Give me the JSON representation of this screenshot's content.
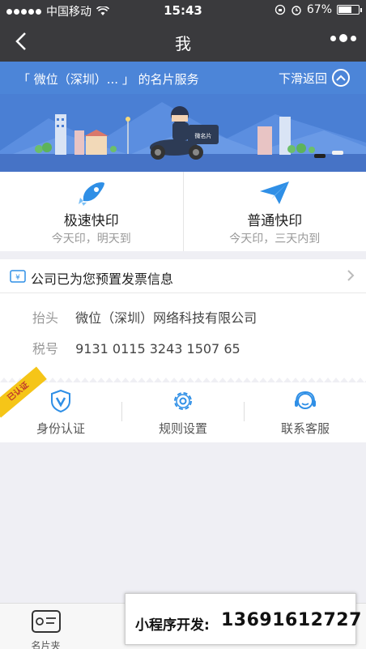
{
  "status_bar": {
    "carrier": "中国移动",
    "time": "15:43",
    "battery_percent": "67%",
    "battery_level": 0.67
  },
  "nav": {
    "title": "我"
  },
  "banner": {
    "service_prefix": "「 微位（深圳）...  」 的名片服务",
    "slide_back": "下滑返回",
    "scooter_text": "微名片"
  },
  "print_options": [
    {
      "name": "极速快印",
      "desc": "今天印，明天到",
      "icon": "rocket-icon"
    },
    {
      "name": "普通快印",
      "desc": "今天印，三天内到",
      "icon": "paper-plane-icon"
    }
  ],
  "invoice": {
    "header": "公司已为您预置发票信息",
    "title_label": "抬头",
    "title_value": "微位（深圳）网络科技有限公司",
    "tax_label": "税号",
    "tax_value": "9131 0115 3243 1507 65"
  },
  "verified_badge": "已认证",
  "features": [
    {
      "label": "身份认证",
      "icon": "shield-v-icon"
    },
    {
      "label": "规则设置",
      "icon": "gear-icon"
    },
    {
      "label": "联系客服",
      "icon": "headset-icon"
    }
  ],
  "tabs": [
    {
      "label": "名片夹",
      "icon": "card-holder-icon"
    },
    {
      "label": "",
      "icon": "tab2-icon"
    },
    {
      "label": "",
      "icon": "tab3-icon"
    },
    {
      "label": "",
      "icon": "tab4-icon"
    }
  ],
  "promo": {
    "label": "小程序开发:",
    "phone": "13691612727"
  },
  "colors": {
    "nav_bg": "#3a3a3d",
    "banner_blue": "#4a7fd4",
    "accent_blue": "#2f8fe6"
  }
}
